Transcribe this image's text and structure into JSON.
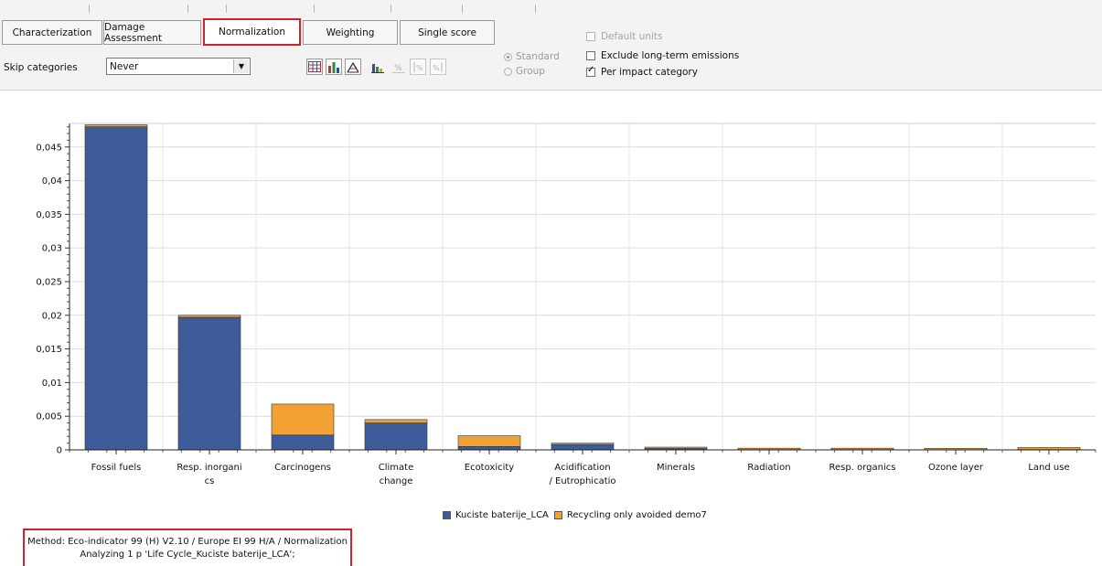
{
  "tabs": [
    {
      "label": "Characterization",
      "active": false
    },
    {
      "label": "Damage Assessment",
      "active": false
    },
    {
      "label": "Normalization",
      "active": true
    },
    {
      "label": "Weighting",
      "active": false
    },
    {
      "label": "Single score",
      "active": false
    }
  ],
  "skip_categories": {
    "label": "Skip categories",
    "value": "Never"
  },
  "toolbar_icons": [
    "table-view-icon",
    "bar-chart-icon",
    "stacked-chart-icon",
    "grouped-bar-icon",
    "percent-icon",
    "sort-percent-asc-icon",
    "sort-percent-desc-icon"
  ],
  "radios": [
    {
      "label": "Standard",
      "selected": true,
      "enabled": false
    },
    {
      "label": "Group",
      "selected": false,
      "enabled": false
    }
  ],
  "checkboxes": [
    {
      "label": "Default units",
      "checked": false,
      "enabled": false
    },
    {
      "label": "Exclude long-term emissions",
      "checked": false,
      "enabled": true
    },
    {
      "label": "Per impact category",
      "checked": true,
      "enabled": true
    }
  ],
  "chart_data": {
    "type": "bar",
    "stacked": true,
    "categories": [
      "Fossil fuels",
      "Resp. inorganics",
      "Carcinogens",
      "Climate change",
      "Ecotoxicity",
      "Acidification / Eutrophication",
      "Minerals",
      "Radiation",
      "Resp. organics",
      "Ozone layer",
      "Land use"
    ],
    "category_labels": [
      [
        "Fossil fuels"
      ],
      [
        "Resp. inorgani",
        "cs"
      ],
      [
        "Carcinogens"
      ],
      [
        "Climate",
        "change"
      ],
      [
        "Ecotoxicity"
      ],
      [
        "Acidification",
        "/ Eutrophicatio"
      ],
      [
        "Minerals"
      ],
      [
        "Radiation"
      ],
      [
        "Resp. organics"
      ],
      [
        "Ozone layer"
      ],
      [
        "Land use"
      ]
    ],
    "series": [
      {
        "name": "Kuciste baterije_LCA",
        "color": "#3e5b9a",
        "values": [
          0.048,
          0.0197,
          0.0022,
          0.004,
          0.0005,
          0.0008,
          0.0002,
          5e-05,
          5e-05,
          3e-05,
          5e-05
        ]
      },
      {
        "name": "Recycling only avoided demo7",
        "color": "#f2a134",
        "values": [
          0.0003,
          0.0003,
          0.0046,
          0.0005,
          0.0016,
          0.0001,
          0.0002,
          0.0002,
          0.0002,
          0.0001,
          0.0003
        ]
      }
    ],
    "yticks": [
      "0",
      "0,005",
      "0,01",
      "0,015",
      "0,02",
      "0,025",
      "0,03",
      "0,035",
      "0,04",
      "0,045"
    ],
    "ylim": [
      0,
      0.0485
    ],
    "grid": true,
    "legend_position": "bottom"
  },
  "method": {
    "line1": "Method: Eco-indicator 99 (H) V2.10 / Europe EI 99 H/A / Normalization",
    "line2": "Analyzing 1 p 'Life Cycle_Kuciste baterije_LCA';"
  }
}
